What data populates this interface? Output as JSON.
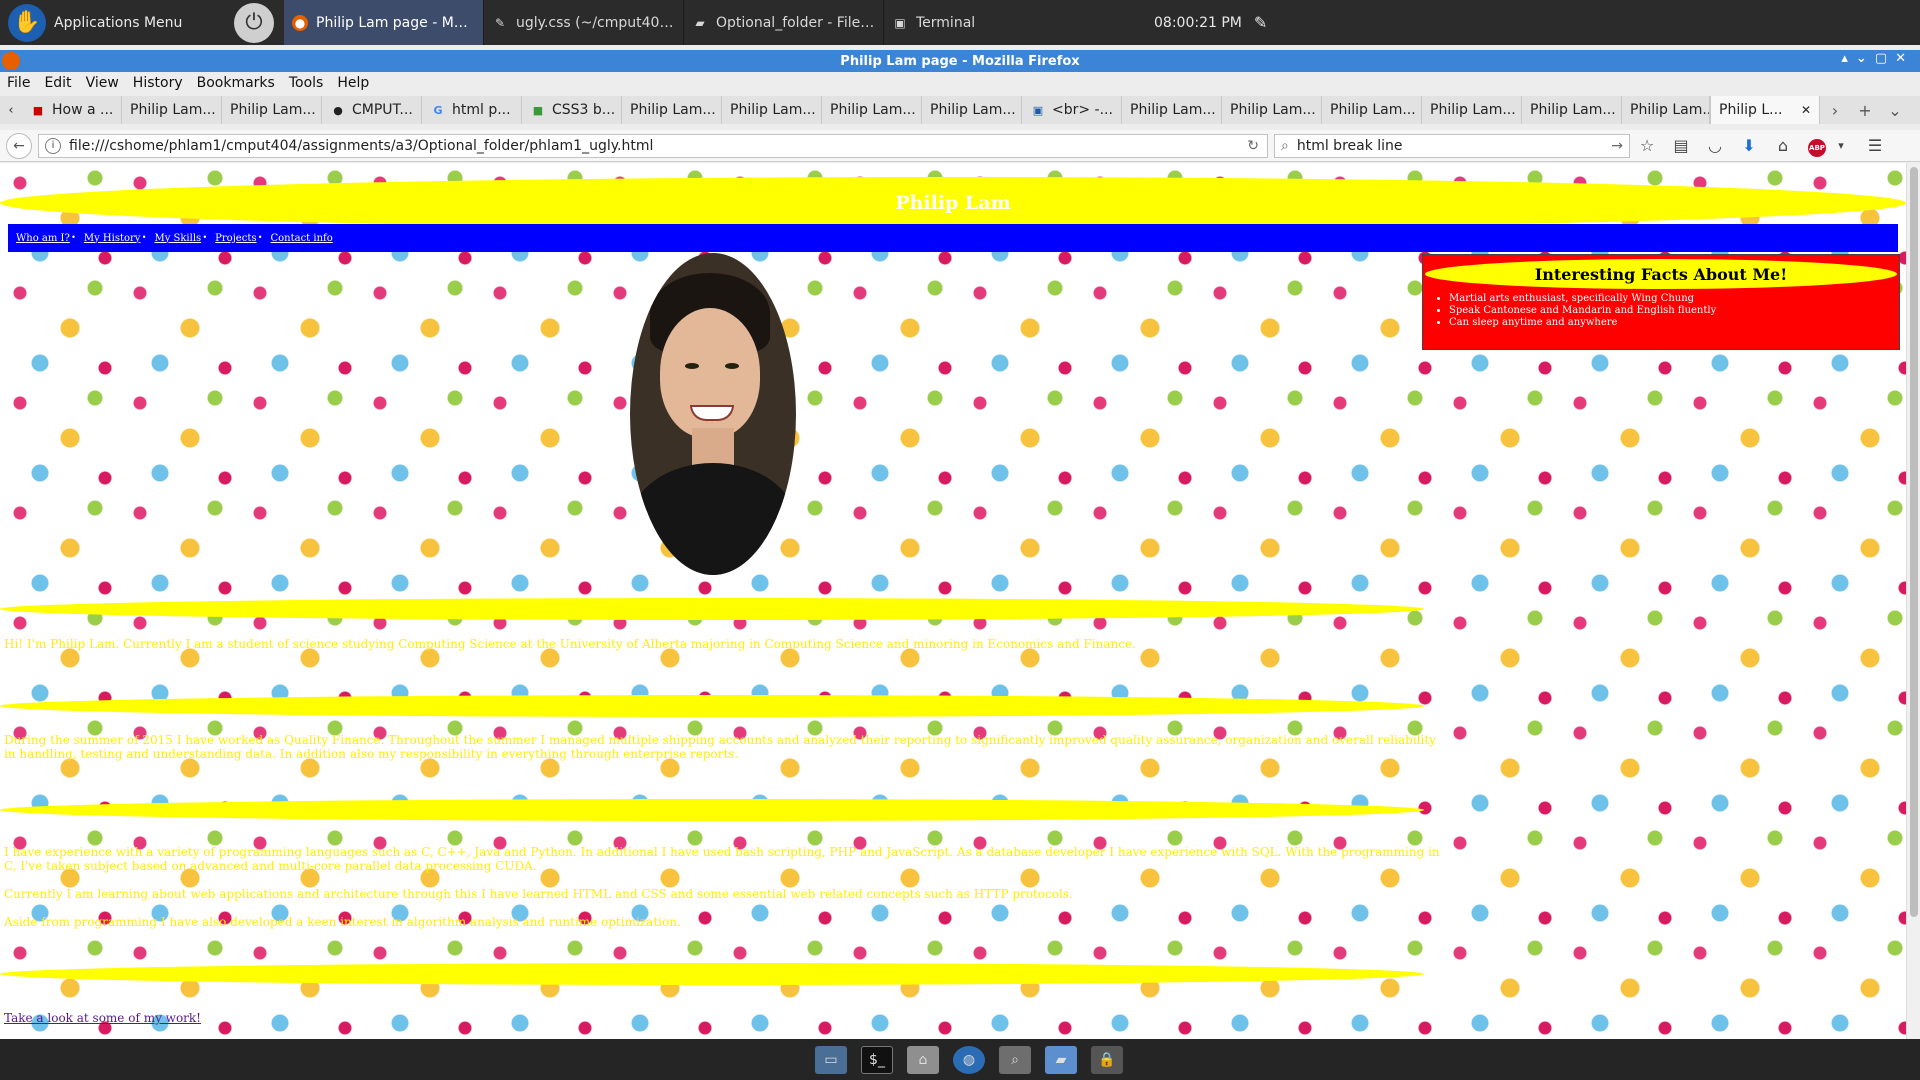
{
  "panel": {
    "apps_menu_label": "Applications Menu",
    "tasks": [
      {
        "label": "Philip Lam page - Mozill...",
        "icon": "firefox-icon",
        "active": true
      },
      {
        "label": "ugly.css (~/cmput404/a...",
        "icon": "text-editor-icon",
        "active": false
      },
      {
        "label": "Optional_folder - File M...",
        "icon": "folder-icon",
        "active": false
      },
      {
        "label": "Terminal",
        "icon": "terminal-icon",
        "active": false
      }
    ],
    "clock": "08:00:21 PM"
  },
  "firefox": {
    "window_title": "Philip Lam page - Mozilla Firefox",
    "menu": [
      "File",
      "Edit",
      "View",
      "History",
      "Bookmarks",
      "Tools",
      "Help"
    ],
    "tabs": [
      {
        "label": "How a ...",
        "icon": "page-icon"
      },
      {
        "label": "Philip Lam...",
        "icon": ""
      },
      {
        "label": "Philip Lam...",
        "icon": ""
      },
      {
        "label": "CMPUT...",
        "icon": "github-icon"
      },
      {
        "label": "html p...",
        "icon": "google-icon"
      },
      {
        "label": "CSS3 b...",
        "icon": "css-icon"
      },
      {
        "label": "Philip Lam...",
        "icon": ""
      },
      {
        "label": "Philip Lam...",
        "icon": ""
      },
      {
        "label": "Philip Lam...",
        "icon": ""
      },
      {
        "label": "Philip Lam...",
        "icon": ""
      },
      {
        "label": "<br> -...",
        "icon": "w3-icon"
      },
      {
        "label": "Philip Lam...",
        "icon": ""
      },
      {
        "label": "Philip Lam...",
        "icon": ""
      },
      {
        "label": "Philip Lam...",
        "icon": ""
      },
      {
        "label": "Philip Lam...",
        "icon": ""
      },
      {
        "label": "Philip Lam...",
        "icon": ""
      },
      {
        "label": "Philip Lam...",
        "icon": ""
      }
    ],
    "active_tab_label": "Philip L...",
    "url": "file:///cshome/phlam1/cmput404/assignments/a3/Optional_folder/phlam1_ugly.html",
    "search_value": "html break line",
    "abp_label": "ABP"
  },
  "page": {
    "header_title": "Philip Lam",
    "nav": [
      "Who am I?",
      "My History",
      "My Skills",
      "Projects",
      "Contact info"
    ],
    "facts_title": "Interesting Facts About Me!",
    "facts": [
      "Martial arts enthusiast, specifically Wing Chung",
      "Speak Cantonese and Mandarin and English fluently",
      "Can sleep anytime and anywhere"
    ],
    "para_1": "Hi! I'm Philip Lam. Currently I am a student of science studying Computing Science at the University of Alberta majoring in Computing Science and minoring in Economics and Finance.",
    "para_2": "During the summer of 2015 I have worked as Quality Finance. Throughout the summer I managed multiple shipping accounts and analyzed their reporting to significantly improved quality assurance, organization and overall reliability in handling, testing and understanding data. In addition also my responsibility in everything through enterprise reports.",
    "para_3": "I have experience with a variety of programming languages such as C, C++, Java and Python. In additional I have used bash scripting, PHP and JavaScript. As a database developer I have experience with SQL. With the programming in C, I've taken subject based on advanced and multi-core parallel data processing CUDA.",
    "para_4": "Currently I am learning about web applications and architecture through this I have learned HTML and CSS and some essential web related concepts such as HTTP protocols.",
    "para_5": "Aside from programming I have also developed a keen interest in algorithm analysis and runtime optimization.",
    "work_link": "Take a look at some of my work!"
  },
  "colors": {
    "header_yellow": "#ffff00",
    "nav_blue": "#0000ff",
    "facts_red": "#ff0000",
    "titlebar_blue": "#3c84d6"
  }
}
